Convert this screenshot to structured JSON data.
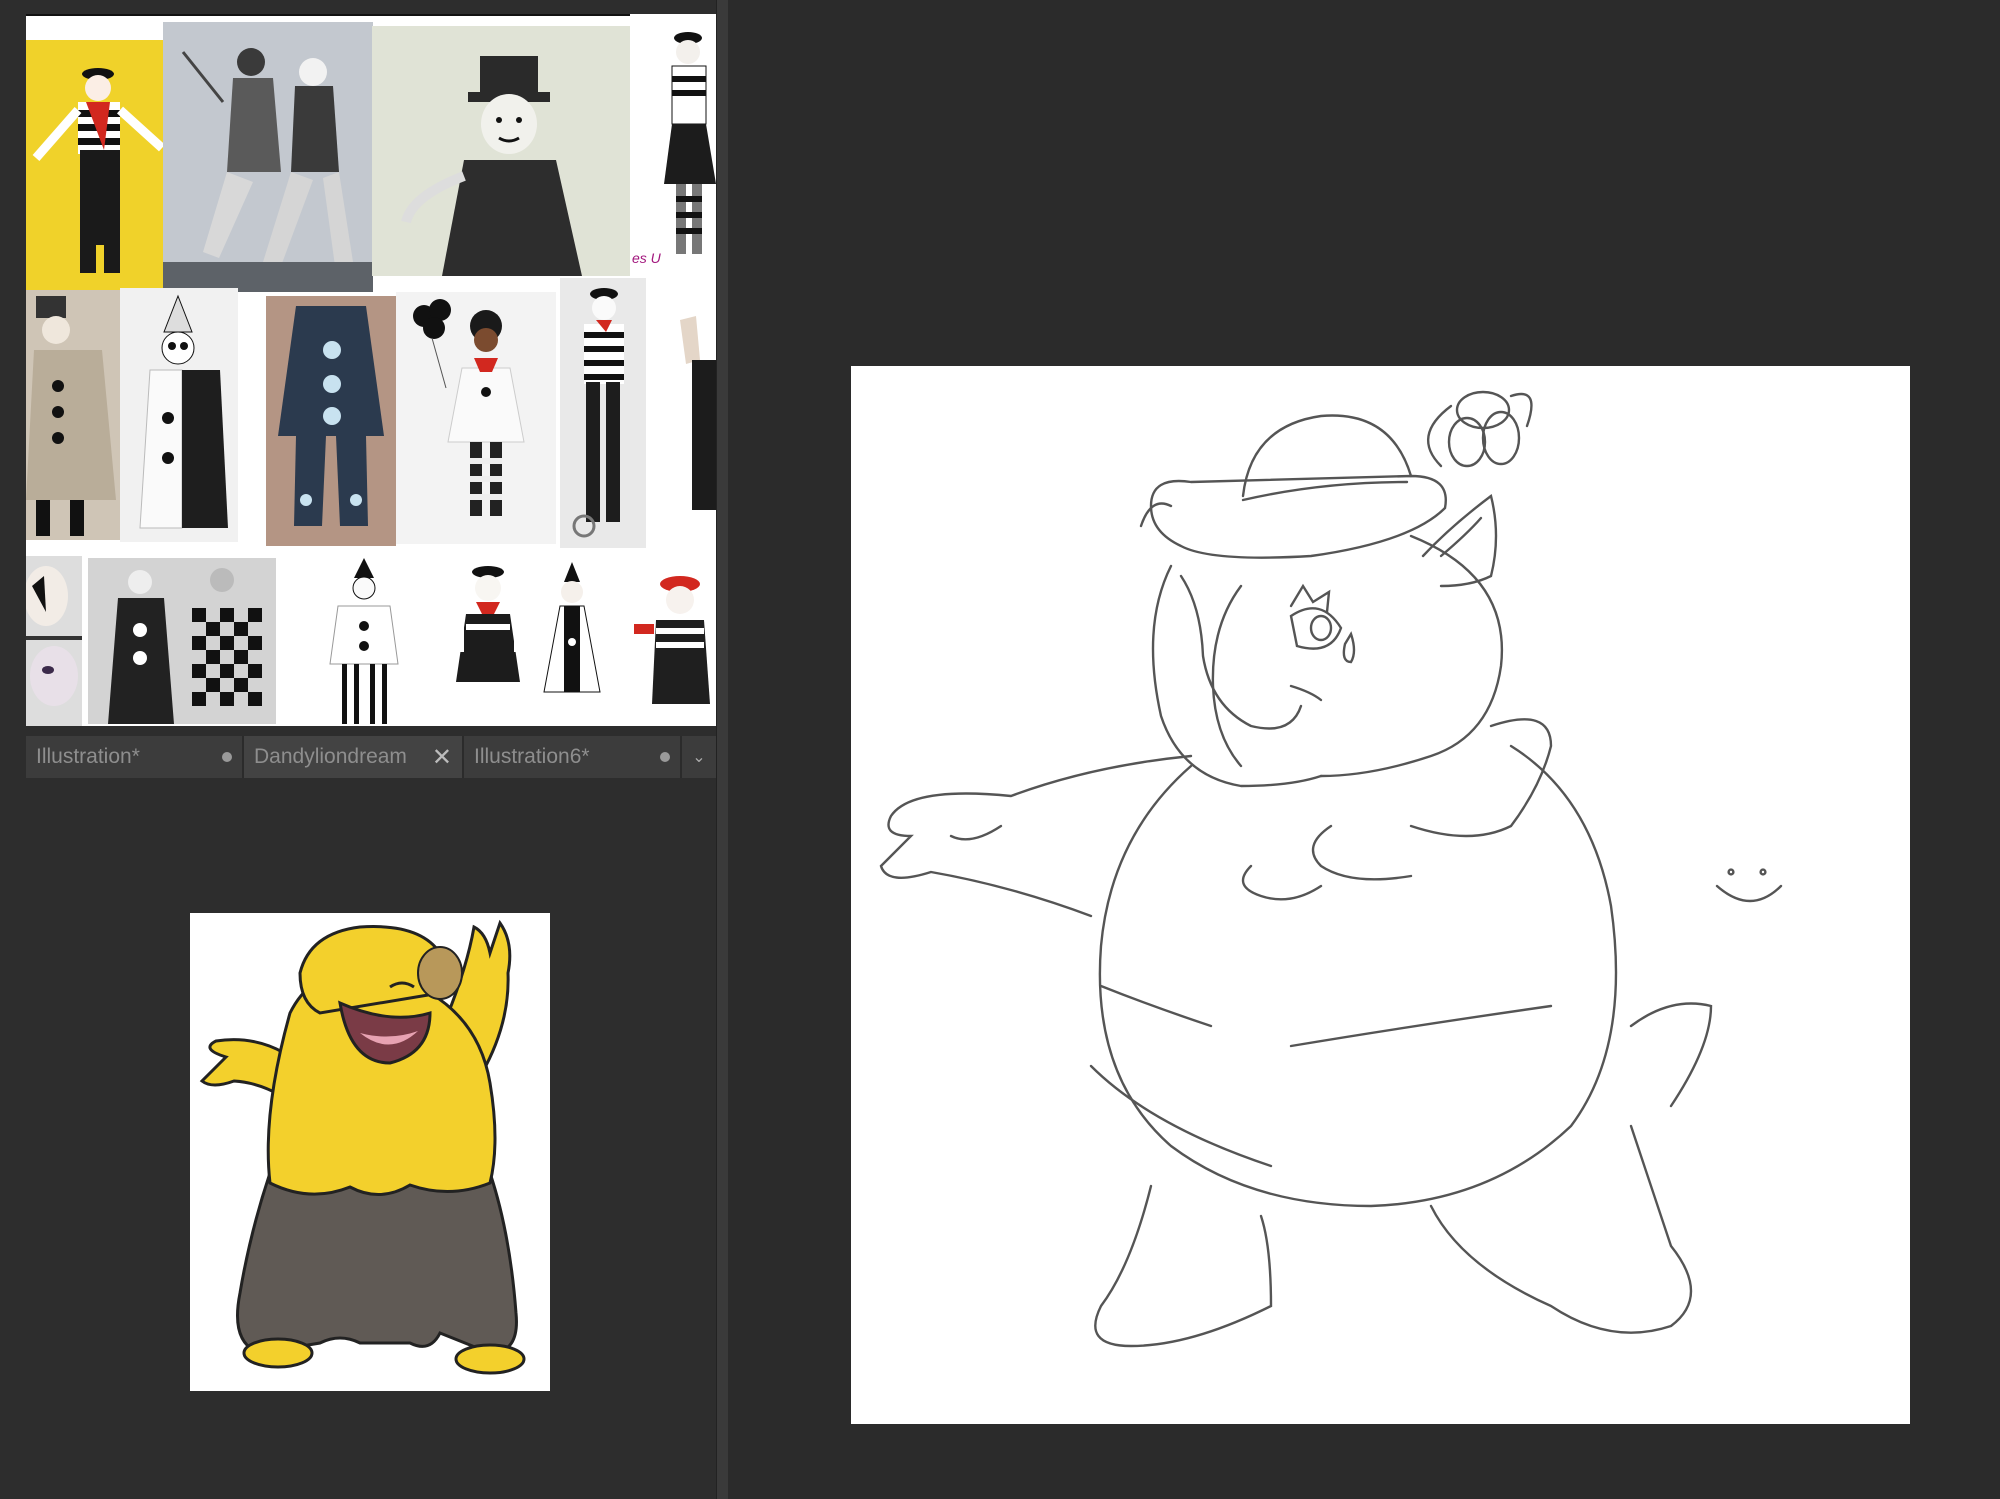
{
  "tabs": [
    {
      "label": "Illustration*",
      "state": "modified"
    },
    {
      "label": "Dandyliondream",
      "state": "active-closable"
    },
    {
      "label": "Illustration6*",
      "state": "modified"
    }
  ],
  "tab_menu_icon": "chevron-down-icon",
  "reference_board": {
    "tiles": [
      "mime-yellow",
      "pierrot-duo",
      "mime-hat-portrait",
      "mime-striped-dress",
      "pierrot-beige",
      "pierrot-black-white",
      "pierrot-navy-costume",
      "clown-balloons",
      "mime-suspenders",
      "partial-figure",
      "sad-face-makeup",
      "harlequin-photo",
      "pierrot-striped",
      "mime-red-scarf",
      "harlequin-dress",
      "mime-red-beret"
    ],
    "watermark_text": "es U"
  },
  "colors": {
    "accent_yellow": "#f3d02c",
    "accent_red": "#d2281f",
    "workspace_bg": "#2b2b2b",
    "tab_bar_bg": "#3c3c3c"
  }
}
